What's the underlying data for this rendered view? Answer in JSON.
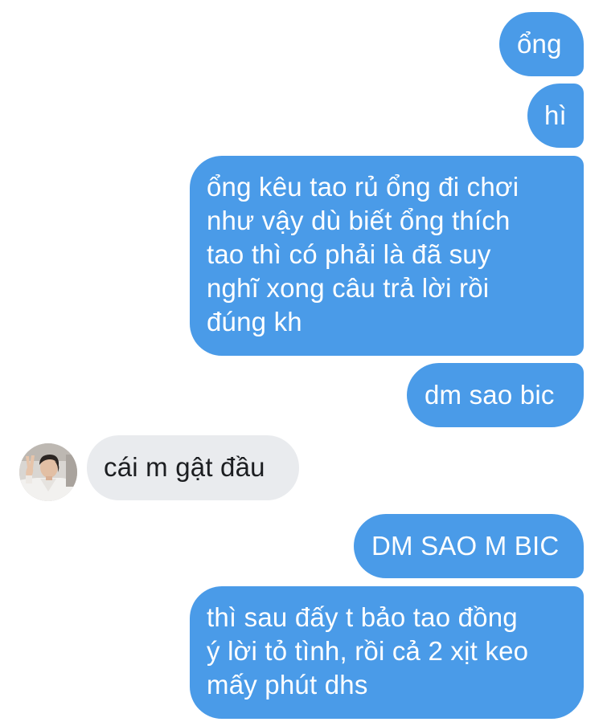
{
  "messages": [
    {
      "direction": "outgoing",
      "text": "ổng"
    },
    {
      "direction": "outgoing",
      "text": "hì"
    },
    {
      "direction": "outgoing",
      "text": "ổng kêu tao rủ ổng đi chơi\nnhư vậy dù biết ổng thích\ntao thì có phải là đã suy\nnghĩ xong câu trả lời rồi\nđúng kh"
    },
    {
      "direction": "outgoing",
      "text": "dm sao bic"
    },
    {
      "direction": "incoming",
      "text": "cái m gật đầu"
    },
    {
      "direction": "outgoing",
      "text": "DM SAO M BIC"
    },
    {
      "direction": "outgoing",
      "text": "thì sau đấy t bảo tao đồng\ný lời tỏ tình, rồi cả 2 xịt keo\nmấy phút dhs"
    }
  ],
  "colors": {
    "outgoing_bubble": "#4a9be8",
    "outgoing_text": "#ffffff",
    "incoming_bubble": "#e9ebee",
    "incoming_text": "#1c1e21",
    "background": "#ffffff"
  },
  "icons": {
    "avatar": "contact-avatar-photo"
  }
}
